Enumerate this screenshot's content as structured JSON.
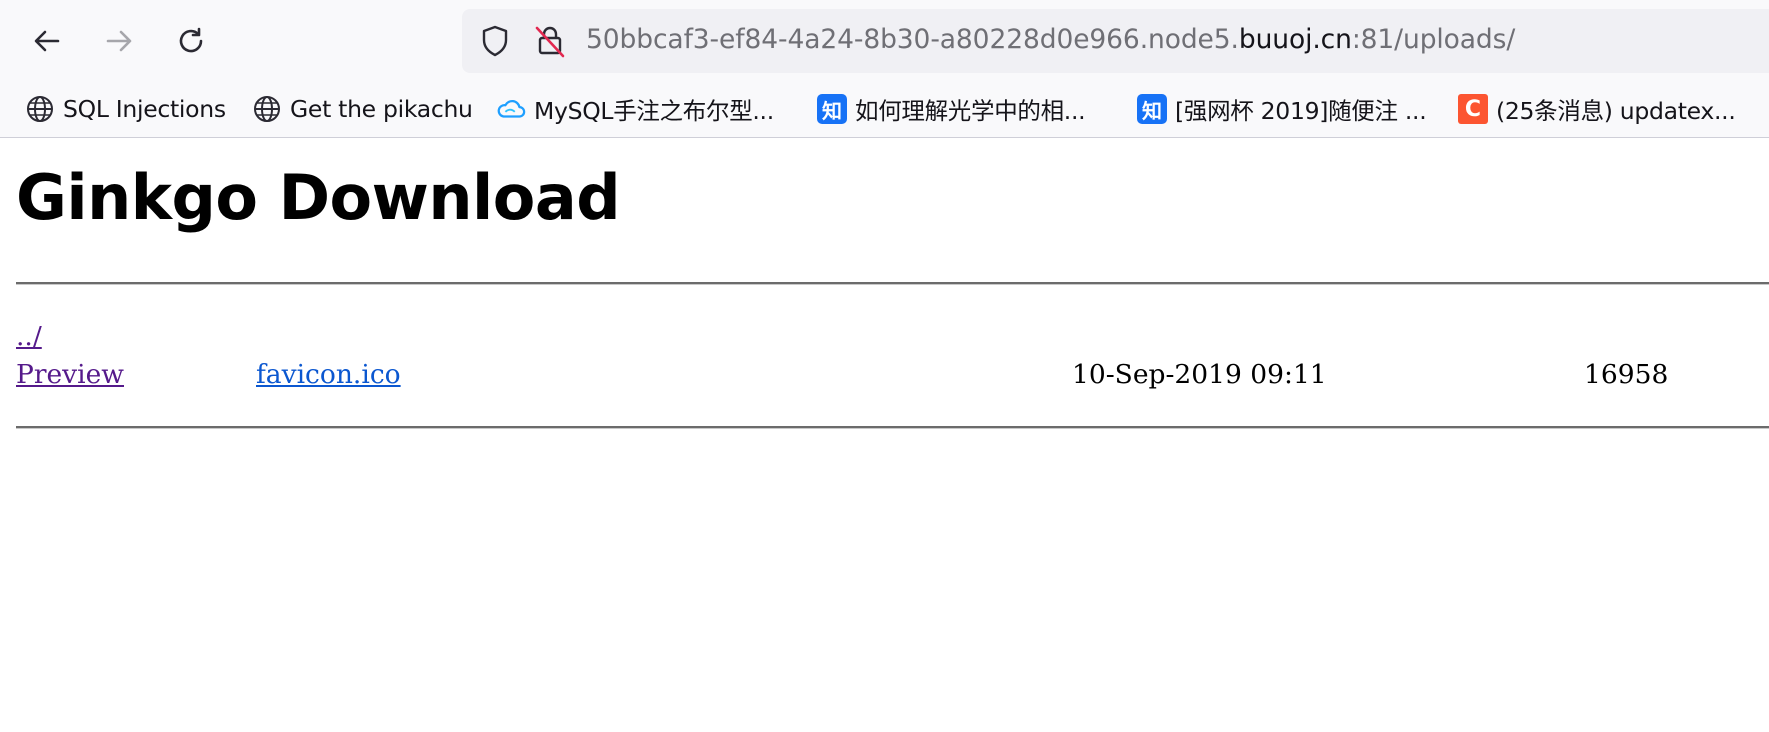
{
  "browser": {
    "nav": {
      "back_icon": "arrow-left-icon",
      "forward_icon": "arrow-right-icon",
      "reload_icon": "reload-icon"
    },
    "urlbar": {
      "url_prefix": "50bbcaf3-ef84-4a24-8b30-a80228d0e966.node5.",
      "url_host": "buuoj.cn",
      "url_suffix": ":81/uploads/",
      "shield_icon": "shield-icon",
      "lock_icon": "insecure-lock-icon"
    },
    "bookmarks": [
      {
        "label": "SQL Injections",
        "icon": "globe-icon"
      },
      {
        "label": "Get the pikachu",
        "icon": "globe-icon"
      },
      {
        "label": "MySQL手注之布尔型...",
        "icon": "cloud-icon"
      },
      {
        "label": "如何理解光学中的相...",
        "icon": "zhihu-icon",
        "icon_text": "知"
      },
      {
        "label": "[强网杯 2019]随便注 ...",
        "icon": "zhihu-icon",
        "icon_text": "知"
      },
      {
        "label": "(25条消息) updatex...",
        "icon": "csdn-icon",
        "icon_text": "C"
      }
    ]
  },
  "page": {
    "title": "Ginkgo Download",
    "parent_link": "../",
    "rows": [
      {
        "preview_label": "Preview",
        "filename": "favicon.ico",
        "modified": "10-Sep-2019 09:11",
        "size": "16958"
      }
    ]
  },
  "colors": {
    "toolbar_bg": "#f9f9fb",
    "urlbar_bg": "#f0f0f4",
    "visited_link": "#551a8b",
    "link": "#0b57d0",
    "zhihu_blue": "#1772f6",
    "csdn_orange": "#fc5531"
  }
}
